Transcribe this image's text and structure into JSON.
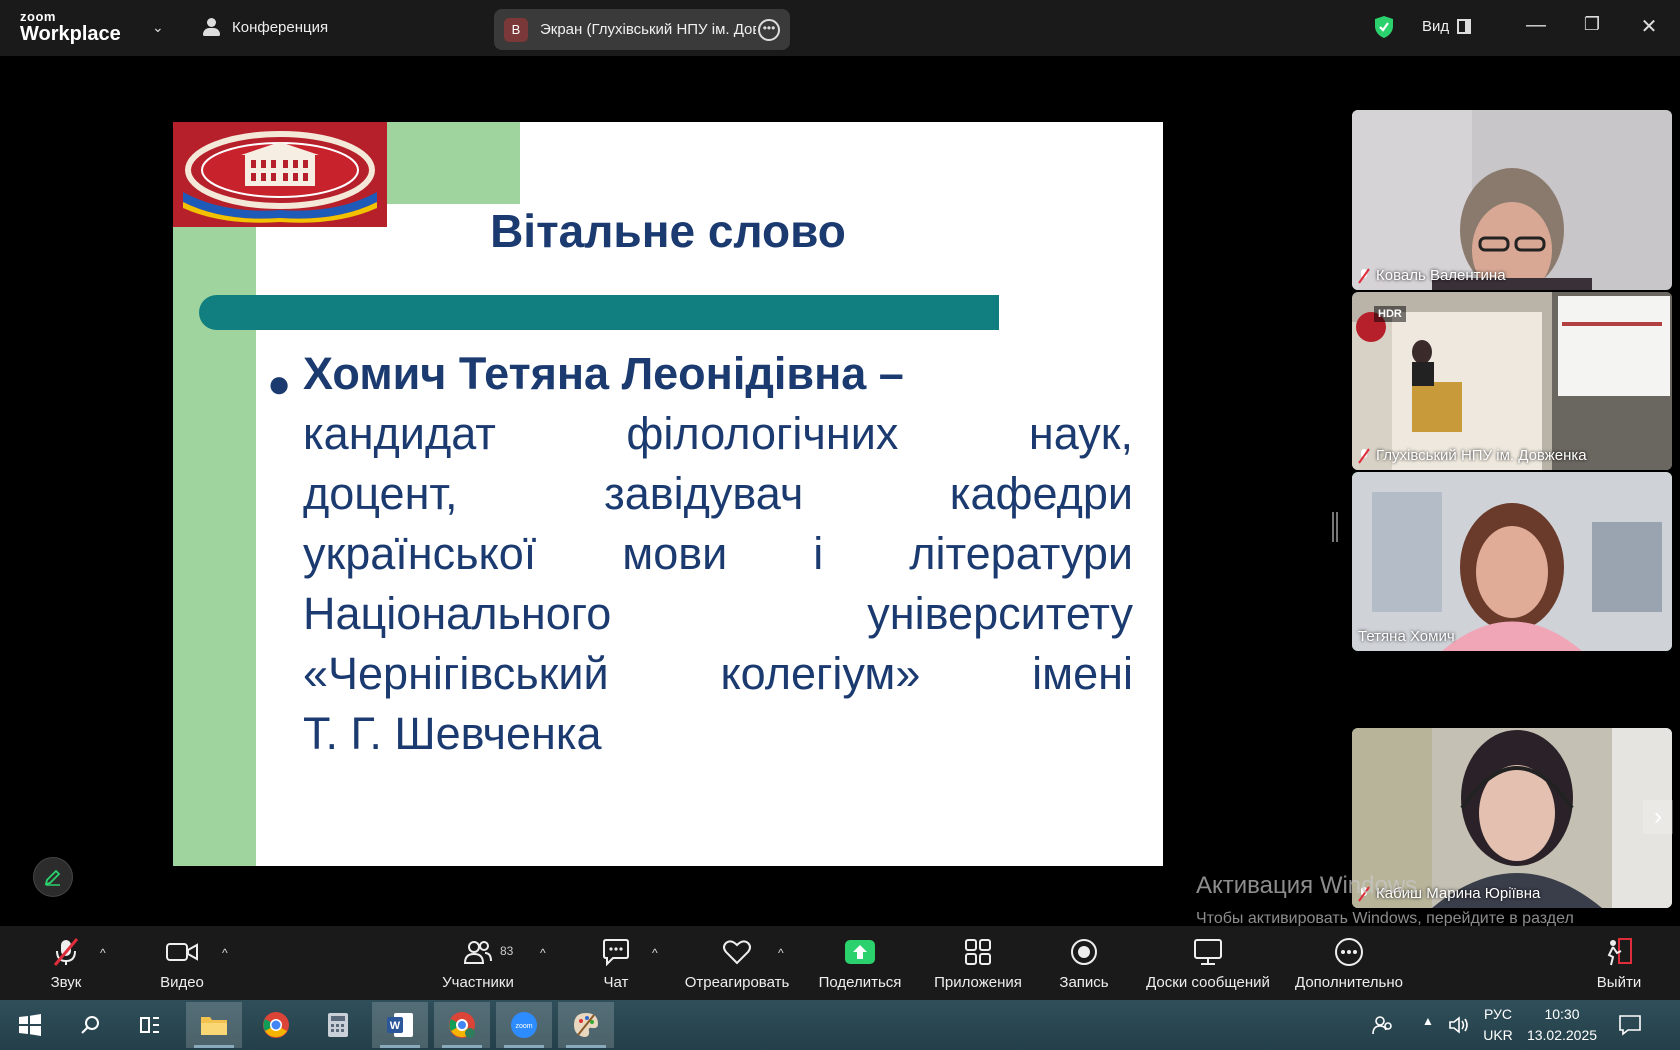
{
  "topbar": {
    "brand_small": "zoom",
    "brand": "Workplace",
    "meeting_label": "Конференция",
    "share_badge": "B",
    "share_title": "Экран (Глухівський НПУ ім. Довженка)",
    "view_label": "Вид"
  },
  "slide": {
    "title": "Вітальне слово",
    "name_line": "Хомич Тетяна Леонідівна –",
    "lines": [
      "кандидат філологічних наук,",
      "доцент, завідувач кафедри",
      "української мови і літератури",
      "Національного університету",
      "«Чернігівський колегіум» імені",
      "Т. Г. Шевченка"
    ]
  },
  "participants": [
    {
      "name": "Коваль Валентина",
      "muted": true
    },
    {
      "name": "Глухівський НПУ ім. Довженка",
      "muted": true,
      "badge": "HDR"
    },
    {
      "name": "Тетяна Хомич",
      "muted": false,
      "active": true
    },
    {
      "name": "Кабиш Марина Юріївна",
      "muted": true
    }
  ],
  "activation": {
    "title": "Активация Windows",
    "text": "Чтобы активировать Windows, перейдите в раздел \"Параметры\"."
  },
  "toolbar": {
    "audio": "Звук",
    "video": "Видео",
    "participants": "Участники",
    "participants_count": "83",
    "chat": "Чат",
    "react": "Отреагировать",
    "share": "Поделиться",
    "apps": "Приложения",
    "record": "Запись",
    "boards": "Доски сообщений",
    "more": "Дополнительно",
    "leave": "Выйти"
  },
  "taskbar": {
    "lang_top": "РУС",
    "lang_bottom": "UKR",
    "time": "10:30",
    "date": "13.02.2025"
  },
  "colors": {
    "accent_green": "#2bd16c",
    "slide_title": "#1b3a70",
    "slide_rule": "#117f7f",
    "slide_green": "#a0d49e",
    "leave_red": "#e02d3c"
  }
}
